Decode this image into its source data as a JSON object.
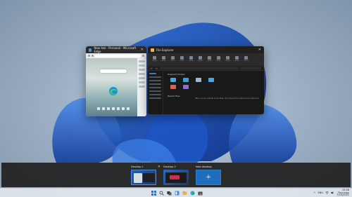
{
  "edge_window": {
    "title": "New tab - Personal - Microsoft Edge"
  },
  "explorer_window": {
    "title": "File Explorer",
    "section_frequent": "Frequent folders",
    "section_recent": "Recent files",
    "empty_message": "After you've opened some files, we'll show the most recent ones here."
  },
  "task_view": {
    "desktops": [
      {
        "label": "Desktop 1",
        "active": true
      },
      {
        "label": "Desktop 2",
        "active": false
      }
    ],
    "new_desktop_label": "New desktop",
    "close_glyph": "✕",
    "plus_glyph": "+"
  },
  "taskbar": {
    "icons": [
      "windows-start-icon",
      "search-icon",
      "task-view-icon",
      "widgets-icon",
      "file-explorer-icon",
      "edge-icon",
      "store-icon"
    ],
    "tray_chevron": "^",
    "input_language": "ENG",
    "clock_time": "10:08",
    "clock_day": "Thursday",
    "clock_date": "7/15/2021"
  },
  "colors": {
    "accent": "#4a90e2",
    "folder_yellow": "#e8b84a",
    "folder_blue": "#4fa3e0",
    "taskbar_bg": "#dee4ea",
    "taskview_bg": "#242424"
  }
}
